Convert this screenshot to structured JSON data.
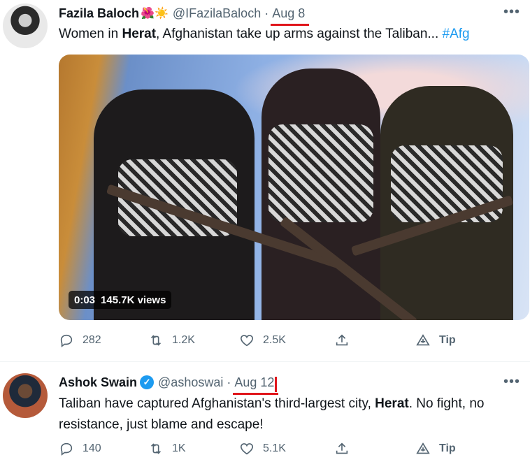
{
  "tweets": [
    {
      "name": "Fazila Baloch",
      "emoji": "🌺☀️",
      "handle": "@IFazilaBaloch",
      "separator": "·",
      "date": "Aug 8",
      "text_prefix": "Women in ",
      "text_bold": "Herat",
      "text_suffix": ", Afghanistan take up arms against the Taliban... ",
      "hashtag": "#Afg",
      "video": {
        "duration": "0:03",
        "views": "145.7K views"
      },
      "actions": {
        "replies": "282",
        "retweets": "1.2K",
        "likes": "2.5K",
        "tip": "Tip"
      }
    },
    {
      "name": "Ashok Swain",
      "verified_mark": "✓",
      "handle": "@ashoswai",
      "separator": "·",
      "date": "Aug 12",
      "text_prefix": "Taliban have captured Afghanistan's third-largest city, ",
      "text_bold": "Herat",
      "text_suffix": ". No fight, no resistance, just blame and escape!",
      "actions": {
        "replies": "140",
        "retweets": "1K",
        "likes": "5.1K",
        "tip": "Tip"
      }
    }
  ],
  "more_label": "•••",
  "icons": {
    "reply": "reply-icon",
    "retweet": "retweet-icon",
    "like": "heart-icon",
    "share": "share-icon",
    "tip": "tip-icon",
    "verified": "verified-badge-icon"
  },
  "colors": {
    "accent": "#1d9bf0",
    "muted": "#536471",
    "highlight_underline": "#e0161c"
  }
}
